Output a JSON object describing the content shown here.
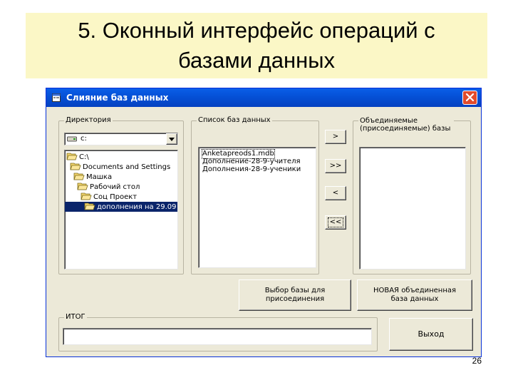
{
  "slide": {
    "title_line1": "5. Оконный интерфейс операций с",
    "title_line2": "базами данных",
    "page_number": "26"
  },
  "window": {
    "title": "Слияние баз данных",
    "accent_color": "#0550d6",
    "close_color": "#e24b2c"
  },
  "directory": {
    "legend": "Директория",
    "drive_value": "c:",
    "tree": [
      {
        "label": "C:\\",
        "indent": 0,
        "selected": false
      },
      {
        "label": "Documents and Settings",
        "indent": 1,
        "selected": false
      },
      {
        "label": "Машка",
        "indent": 2,
        "selected": false
      },
      {
        "label": "Рабочий стол",
        "indent": 3,
        "selected": false
      },
      {
        "label": "Соц Проект",
        "indent": 4,
        "selected": false
      },
      {
        "label": "дополнения на 29.09",
        "indent": 5,
        "selected": true
      }
    ]
  },
  "db_list": {
    "legend": "Список баз данных",
    "items": [
      "Anketapreods1.mdb",
      "Дополнение-28-9-учителя",
      "Дополнения-28-9-ученики"
    ]
  },
  "buttons": {
    "add_one": ">",
    "add_all": ">>",
    "remove_one": "<",
    "remove_all": "<<",
    "select_db": "Выбор базы для присоединения",
    "new_db": "НОВАЯ объединенная база данных",
    "exit": "Выход"
  },
  "merged": {
    "legend": "Объединяемые (присоединяемые) базы"
  },
  "result": {
    "legend": "ИТОГ",
    "value": ""
  }
}
